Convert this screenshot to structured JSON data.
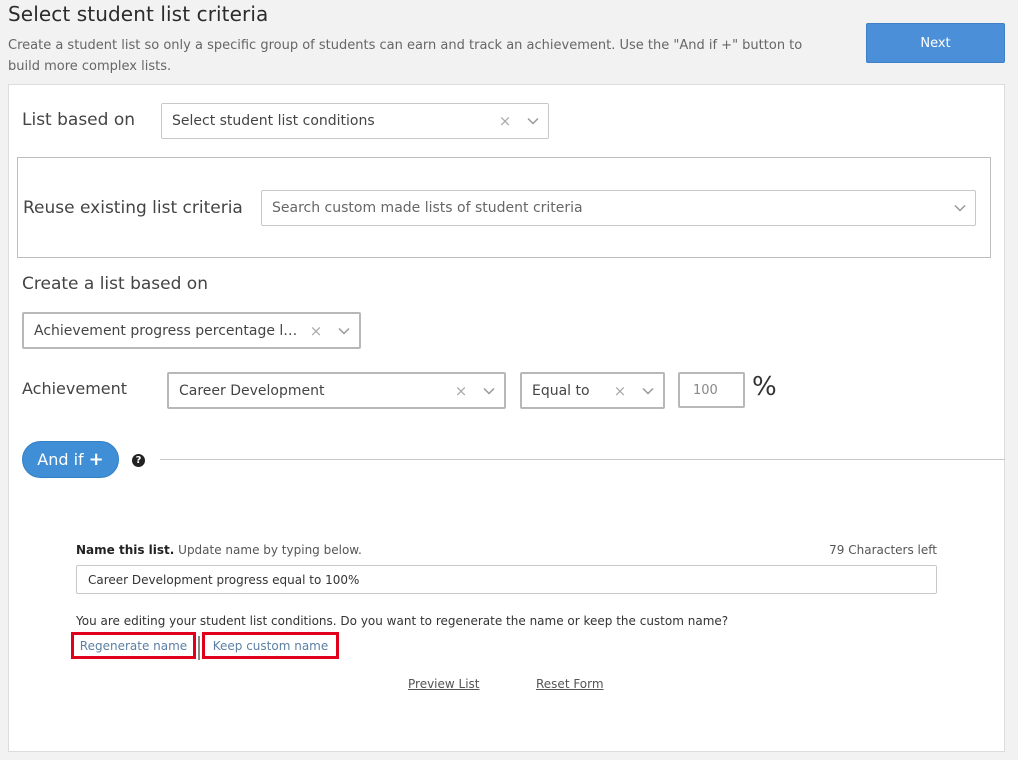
{
  "header": {
    "title": "Select student list criteria",
    "description": "Create a student list so only a specific group of students can earn and track an achievement. Use the \"And if +\" button to build more complex lists.",
    "next_label": "Next"
  },
  "list_based_on": {
    "label": "List based on",
    "value": "Select student list conditions",
    "clear_glyph": "×"
  },
  "reuse": {
    "label": "Reuse existing list criteria",
    "placeholder": "Search custom made lists of student criteria"
  },
  "create": {
    "label": "Create a list based on",
    "value": "Achievement progress percentage le…",
    "clear_glyph": "×"
  },
  "achievement": {
    "label": "Achievement",
    "value": "Career Development",
    "operator": "Equal to",
    "amount": "100",
    "unit": "%",
    "clear_glyph": "×"
  },
  "and_if": {
    "label": "And if",
    "plus": "+",
    "help_glyph": "?"
  },
  "name_list": {
    "label_bold": "Name this list.",
    "label_rest": " Update name by typing below.",
    "chars_left": "79 Characters left",
    "value": "Career Development progress equal to 100%",
    "editing_message": "You are editing your student list conditions. Do you want to regenerate the name or keep the custom name?",
    "regenerate_label": "Regenerate name",
    "keep_label": "Keep custom name"
  },
  "footer": {
    "preview_label": "Preview List",
    "reset_label": "Reset Form"
  },
  "colors": {
    "primary": "#4a8fd8",
    "highlight": "#e0001b",
    "link": "#5b7fa6"
  }
}
